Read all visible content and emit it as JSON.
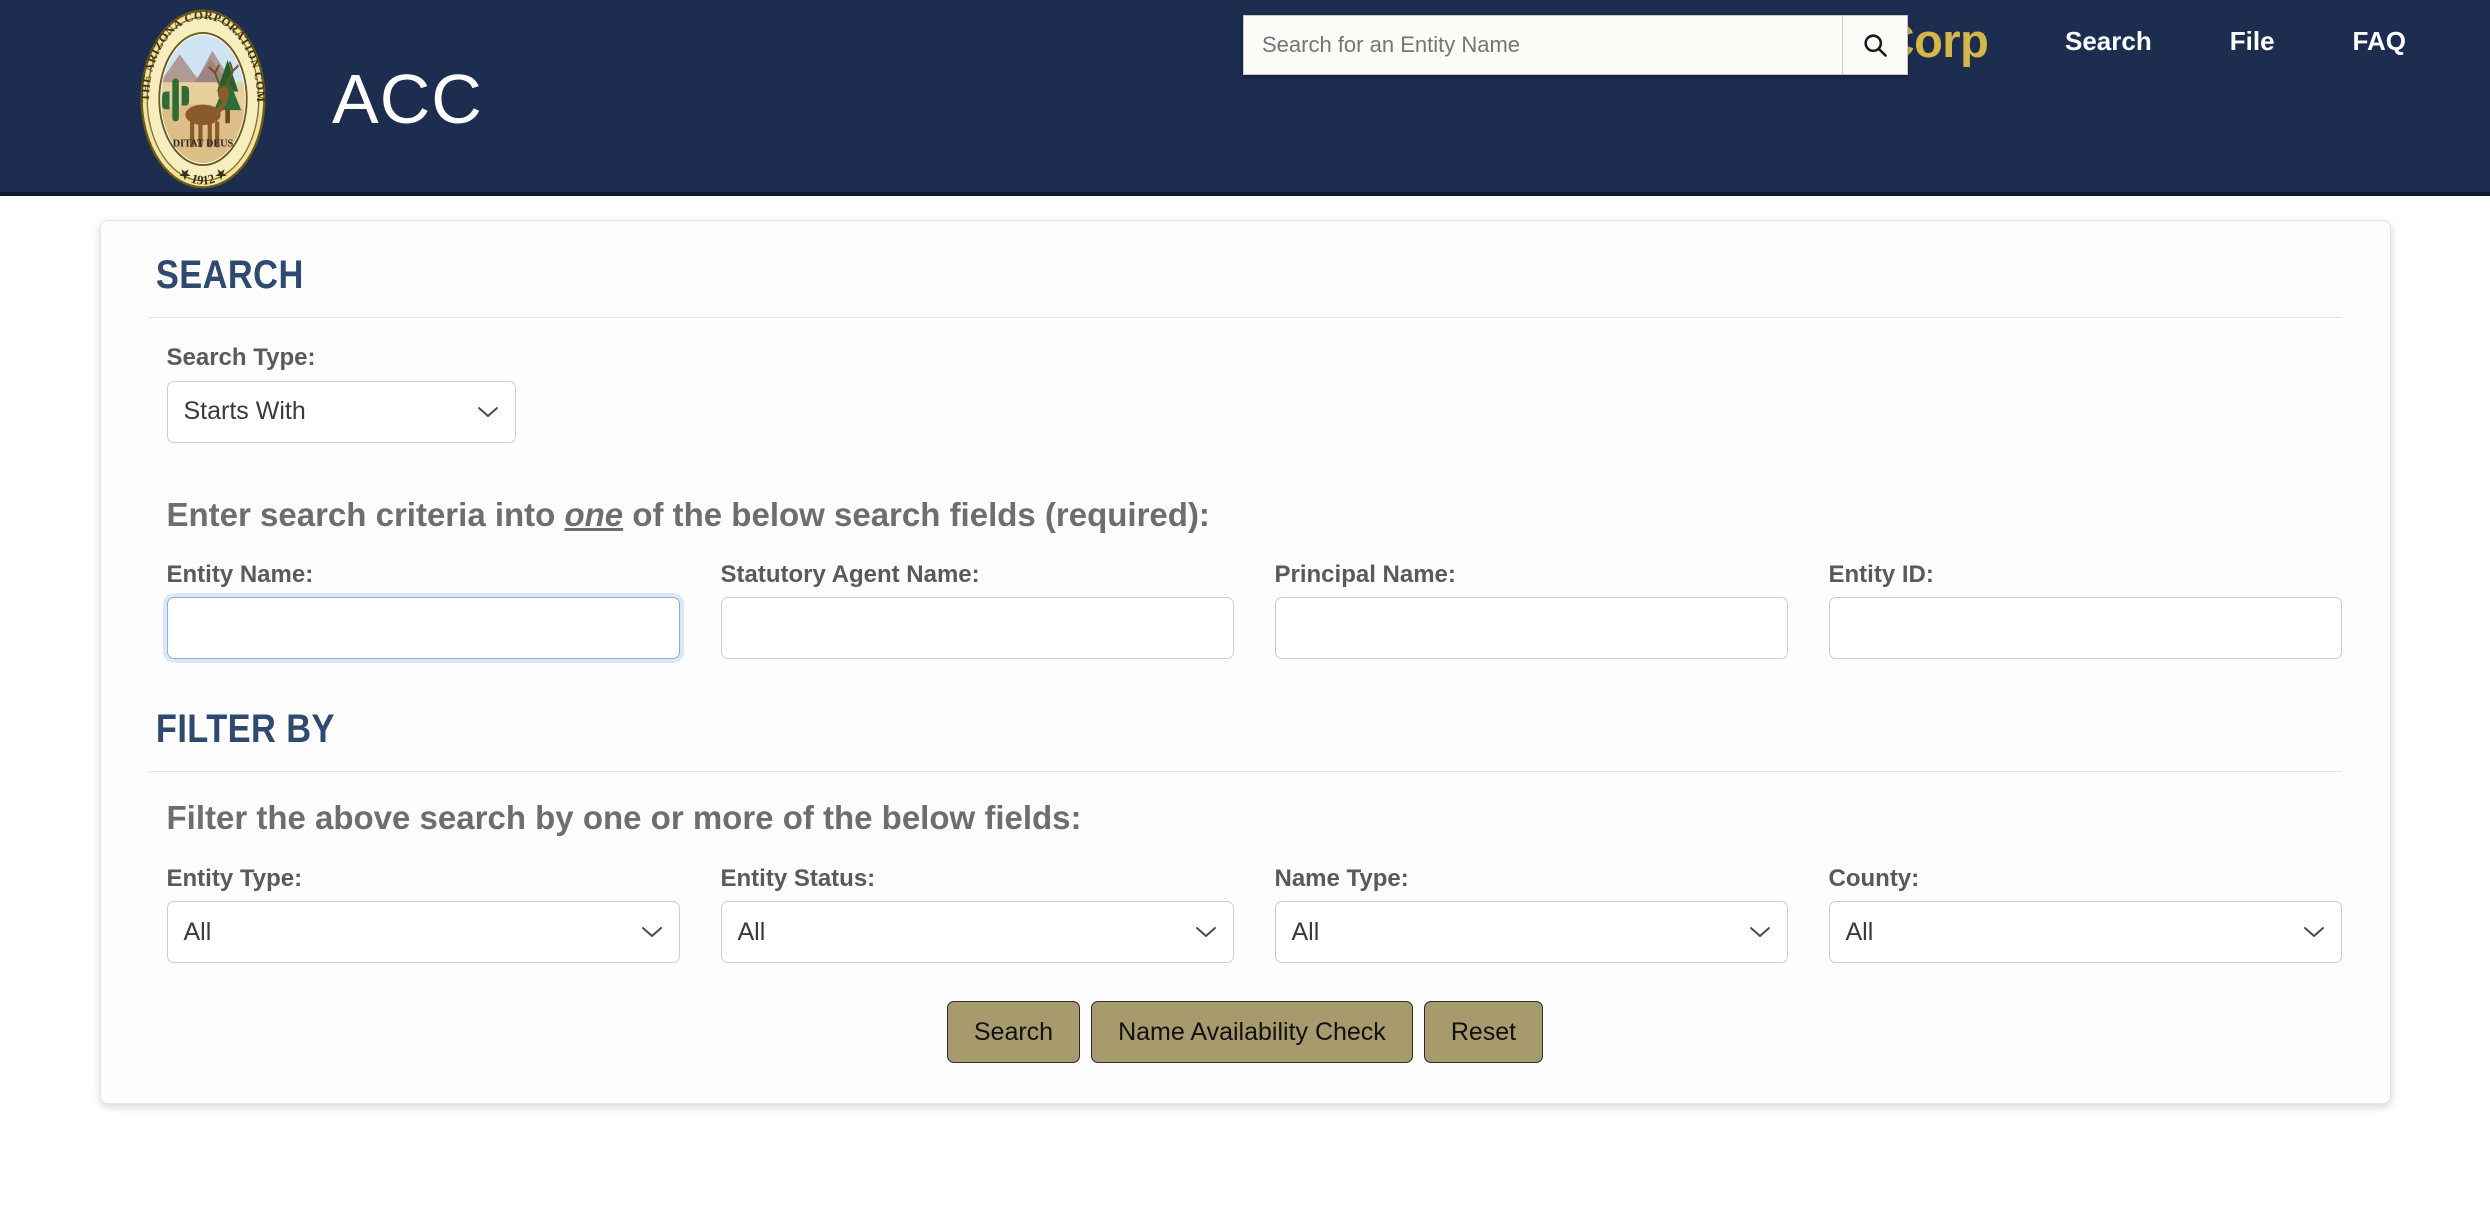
{
  "header": {
    "agency_abbrev": "ACC",
    "seal_text": {
      "outer_top": "SEAL OF THE ARIZONA CORPORATION COMMISSION",
      "motto": "DITAT DEUS",
      "year": "1912"
    },
    "brand": "eCorp",
    "search": {
      "placeholder": "Search for an Entity Name",
      "value": "",
      "icon": "search-icon"
    },
    "nav": [
      {
        "label": "Search"
      },
      {
        "label": "File"
      },
      {
        "label": "FAQ"
      }
    ],
    "colors": {
      "background": "#1d2d50",
      "brand_gold": "#d4b748",
      "nav_text": "#ffffff"
    }
  },
  "search_section": {
    "heading": "SEARCH",
    "search_type": {
      "label": "Search Type:",
      "value": "Starts With",
      "icon": "chevron-down-icon"
    },
    "criteria_instruction": {
      "before": "Enter search criteria into ",
      "emphasis": "one",
      "after": " of the below search fields (required):"
    },
    "fields": [
      {
        "label": "Entity Name:",
        "value": "",
        "placeholder": "",
        "focused": true,
        "name": "entity-name"
      },
      {
        "label": "Statutory Agent Name:",
        "value": "",
        "placeholder": "",
        "focused": false,
        "name": "statutory-agent-name"
      },
      {
        "label": "Principal Name:",
        "value": "",
        "placeholder": "",
        "focused": false,
        "name": "principal-name"
      },
      {
        "label": "Entity ID:",
        "value": "",
        "placeholder": "",
        "focused": false,
        "name": "entity-id"
      }
    ]
  },
  "filter_section": {
    "heading": "FILTER BY",
    "instruction": "Filter the above search by one or more of the below fields:",
    "filters": [
      {
        "label": "Entity Type:",
        "value": "All",
        "name": "entity-type"
      },
      {
        "label": "Entity Status:",
        "value": "All",
        "name": "entity-status"
      },
      {
        "label": "Name Type:",
        "value": "All",
        "name": "name-type"
      },
      {
        "label": "County:",
        "value": "All",
        "name": "county"
      }
    ]
  },
  "actions": {
    "search": "Search",
    "name_availability": "Name Availability Check",
    "reset": "Reset",
    "button_color": "#a79a6d"
  },
  "theme": {
    "heading_blue": "#30496f",
    "label_gray": "#5a5a5a",
    "instruction_gray": "#6e6e6e",
    "card_background": "#fdfdfd",
    "page_background": "#ffffff"
  }
}
